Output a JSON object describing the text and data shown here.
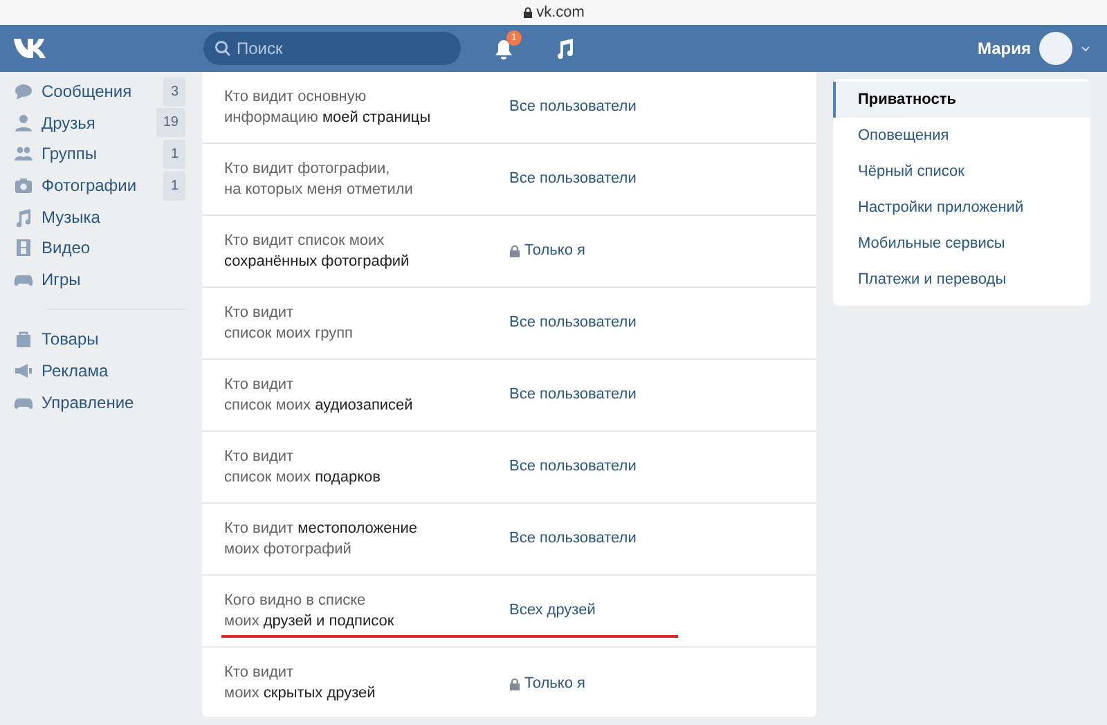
{
  "address_bar": {
    "url": "vk.com"
  },
  "header": {
    "search": {
      "placeholder": "Поиск"
    },
    "notifications": {
      "badge": "1"
    },
    "user": {
      "name": "Мария"
    }
  },
  "sidebar": {
    "groups": [
      {
        "items": [
          {
            "label": "Сообщения",
            "count": "3"
          },
          {
            "label": "Друзья",
            "count": "19"
          },
          {
            "label": "Группы",
            "count": "1"
          },
          {
            "label": "Фотографии",
            "count": "1"
          },
          {
            "label": "Музыка"
          },
          {
            "label": "Видео"
          },
          {
            "label": "Игры"
          }
        ]
      },
      {
        "items": [
          {
            "label": "Товары"
          },
          {
            "label": "Реклама"
          },
          {
            "label": "Управление"
          }
        ]
      }
    ]
  },
  "settings": [
    {
      "question": "Кто видит основную\nинформацию **моей страницы**",
      "value": "Все пользователи",
      "locked": false,
      "underlined": false
    },
    {
      "question": "Кто видит фотографии,\nна которых меня отметили",
      "value": "Все пользователи",
      "locked": false,
      "underlined": false
    },
    {
      "question": "Кто видит список моих\n**сохранённых фотографий**",
      "value": "Только я",
      "locked": true,
      "underlined": false
    },
    {
      "question": "Кто видит\nсписок моих групп",
      "value": "Все пользователи",
      "locked": false,
      "underlined": false
    },
    {
      "question": "Кто видит\nсписок моих **аудиозаписей**",
      "value": "Все пользователи",
      "locked": false,
      "underlined": false
    },
    {
      "question": "Кто видит\nсписок моих **подарков**",
      "value": "Все пользователи",
      "locked": false,
      "underlined": false
    },
    {
      "question": "Кто видит **местоположение**\nмоих фотографий",
      "value": "Все пользователи",
      "locked": false,
      "underlined": false
    },
    {
      "question": "Кого видно в списке\nмоих **друзей и подписок**",
      "value": "Всех друзей",
      "locked": false,
      "underlined": true
    },
    {
      "question": "Кто видит\nмоих **скрытых друзей**",
      "value": "Только я",
      "locked": true,
      "underlined": false
    }
  ],
  "settings_menu": [
    {
      "label": "Приватность",
      "selected": true
    },
    {
      "label": "Оповещения",
      "selected": false
    },
    {
      "label": "Чёрный список",
      "selected": false
    },
    {
      "label": "Настройки приложений",
      "selected": false
    },
    {
      "label": "Мобильные сервисы",
      "selected": false
    },
    {
      "label": "Платежи и переводы",
      "selected": false
    }
  ]
}
